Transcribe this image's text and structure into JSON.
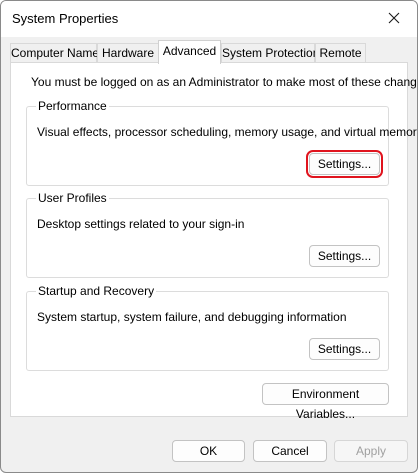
{
  "window": {
    "title": "System Properties",
    "close_icon": "close-icon"
  },
  "tabs": [
    {
      "label": "Computer Name",
      "active": false
    },
    {
      "label": "Hardware",
      "active": false
    },
    {
      "label": "Advanced",
      "active": true
    },
    {
      "label": "System Protection",
      "active": false
    },
    {
      "label": "Remote",
      "active": false
    }
  ],
  "intro_text": "You must be logged on as an Administrator to make most of these changes.",
  "performance": {
    "title": "Performance",
    "description": "Visual effects, processor scheduling, memory usage, and virtual memory",
    "button_label": "Settings..."
  },
  "user_profiles": {
    "title": "User Profiles",
    "description": "Desktop settings related to your sign-in",
    "button_label": "Settings..."
  },
  "startup_recovery": {
    "title": "Startup and Recovery",
    "description": "System startup, system failure, and debugging information",
    "button_label": "Settings..."
  },
  "env_button_label": "Environment Variables...",
  "footer": {
    "ok_label": "OK",
    "cancel_label": "Cancel",
    "apply_label": "Apply"
  },
  "colors": {
    "highlight": "#e0141e"
  }
}
